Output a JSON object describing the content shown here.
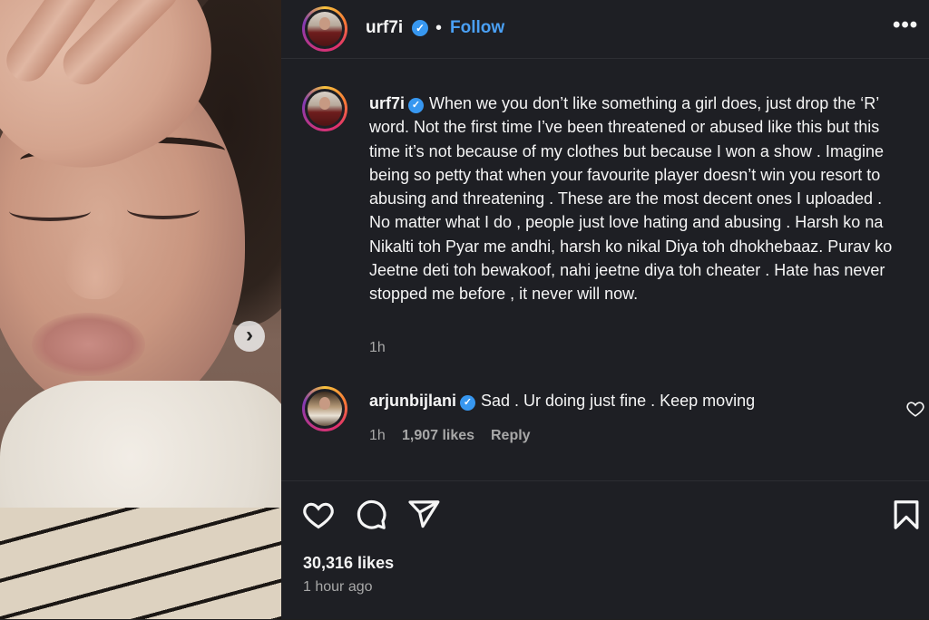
{
  "post": {
    "username": "urf7i",
    "follow_label": "Follow",
    "separator": "•",
    "more_label": "•••"
  },
  "caption": {
    "username": "urf7i",
    "text": "When we you don’t like something a girl does, just drop the ‘R’ word. Not the first time I’ve been threatened or abused like this but this time it’s not because of my clothes but because I won a show . Imagine being so petty that when your favourite player doesn’t win you resort to abusing and threatening . These are the most decent ones I uploaded . No matter what I do , people just love hating and abusing . Harsh ko na Nikalti toh Pyar me andhi, harsh ko nikal Diya toh dhokhebaaz. Purav ko Jeetne deti toh bewakoof, nahi jeetne diya toh cheater . Hate has never stopped me before , it never will now.",
    "time": "1h"
  },
  "comment": {
    "username": "arjunbijlani",
    "text": "Sad . Ur doing just fine . Keep moving",
    "time": "1h",
    "likes": "1,907 likes",
    "reply_label": "Reply"
  },
  "footer": {
    "likes": "30,316 likes",
    "posted_ago": "1 hour ago"
  },
  "icons": {
    "verified": "verified-badge-icon",
    "carousel_next": "chevron-right-icon",
    "like": "heart-icon",
    "comment": "comment-bubble-icon",
    "share": "paper-plane-icon",
    "save": "bookmark-icon",
    "more": "more-horizontal-icon"
  },
  "colors": {
    "background": "#1e1f24",
    "accent": "#4aa0f5",
    "verified": "#3797f0",
    "muted_text": "#a8a8a8"
  }
}
